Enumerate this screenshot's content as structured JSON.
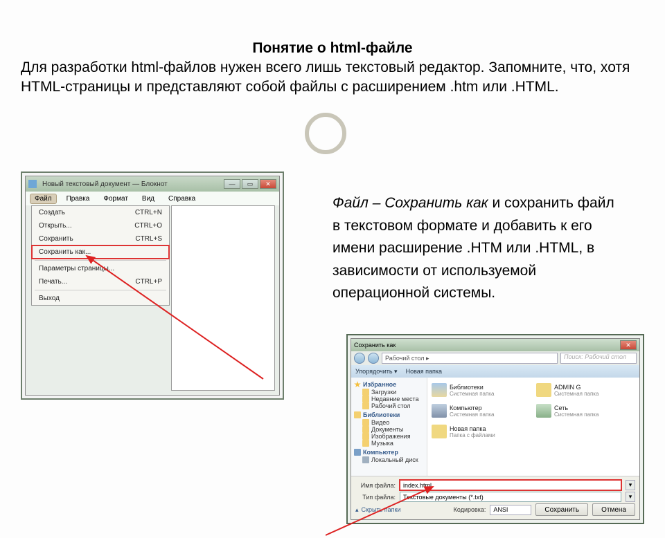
{
  "heading": "Понятие о html-файле",
  "paragraph": "Для разработки html-файлов нужен всего лишь текстовый редактор. Запомните, что, хотя HTML-страницы и представляют собой файлы с расширением .htm или .HTML.",
  "side_text_prefix": "Файл – Сохранить как",
  "side_text_rest": " и сохранить файл в текстовом формате и добавить к его имени расширение .HTM или .HTML, в зависимости от используемой операционной системы.",
  "notepad": {
    "title": "Новый текстовый документ — Блокнот",
    "menu": [
      "Файл",
      "Правка",
      "Формат",
      "Вид",
      "Справка"
    ],
    "items": [
      {
        "label": "Создать",
        "shortcut": "CTRL+N"
      },
      {
        "label": "Открыть...",
        "shortcut": "CTRL+O"
      },
      {
        "label": "Сохранить",
        "shortcut": "CTRL+S"
      },
      {
        "label": "Сохранить как...",
        "shortcut": ""
      },
      {
        "label": "Параметры страницы...",
        "shortcut": ""
      },
      {
        "label": "Печать...",
        "shortcut": "CTRL+P"
      },
      {
        "label": "Выход",
        "shortcut": ""
      }
    ]
  },
  "saveas": {
    "title": "Сохранить как",
    "breadcrumb": "Рабочий стол ▸",
    "search_placeholder": "Поиск: Рабочий стол",
    "toolbar": [
      "Упорядочить ▾",
      "Новая папка"
    ],
    "nav": {
      "fav": "Избранное",
      "fav_items": [
        "Загрузки",
        "Недавние места",
        "Рабочий стол"
      ],
      "lib": "Библиотеки",
      "lib_items": [
        "Видео",
        "Документы",
        "Изображения",
        "Музыка"
      ],
      "comp": "Компьютер",
      "comp_items": [
        "Локальный диск"
      ]
    },
    "files": [
      {
        "name": "Библиотеки",
        "sub": "Системная папка",
        "cls": "lib"
      },
      {
        "name": "ADMIN G",
        "sub": "Системная папка",
        "cls": ""
      },
      {
        "name": "Компьютер",
        "sub": "Системная папка",
        "cls": "pc2"
      },
      {
        "name": "Сеть",
        "sub": "Системная папка",
        "cls": "net2"
      },
      {
        "name": "Новая папка",
        "sub": "Папка с файлами",
        "cls": ""
      }
    ],
    "filename_label": "Имя файла:",
    "filename_value": "index.html",
    "filetype_label": "Тип файла:",
    "filetype_value": "Текстовые документы (*.txt)",
    "hide": "Скрыть папки",
    "encoding_label": "Кодировка:",
    "encoding_value": "ANSI",
    "save": "Сохранить",
    "cancel": "Отмена"
  }
}
